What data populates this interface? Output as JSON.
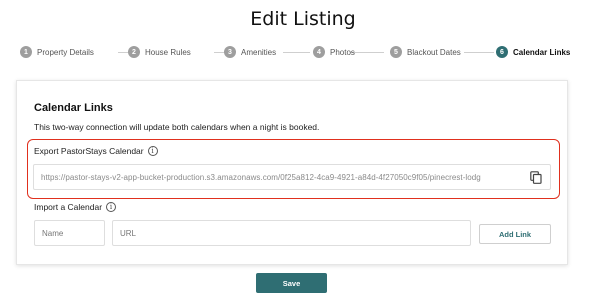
{
  "page": {
    "title": "Edit Listing"
  },
  "stepper": {
    "steps": [
      {
        "number": "1",
        "label": "Property Details"
      },
      {
        "number": "2",
        "label": "House Rules"
      },
      {
        "number": "3",
        "label": "Amenities"
      },
      {
        "number": "4",
        "label": "Photos"
      },
      {
        "number": "5",
        "label": "Blackout Dates"
      },
      {
        "number": "6",
        "label": "Calendar Links"
      }
    ],
    "active_step": "6"
  },
  "card": {
    "title": "Calendar Links",
    "description": "This two-way connection will update both calendars when a night is booked.",
    "export": {
      "label": "Export PastorStays Calendar",
      "url": "https://pastor-stays-v2-app-bucket-production.s3.amazonaws.com/0f25a812-4ca9-4921-a84d-4f27050c9f05/pinecrest-lodg"
    },
    "import": {
      "label": "Import a Calendar",
      "name_placeholder": "Name",
      "url_placeholder": "URL",
      "add_link_label": "Add Link"
    }
  },
  "actions": {
    "save_label": "Save"
  },
  "colors": {
    "accent": "#2f6e73",
    "highlight": "#e0301e",
    "inactive_step": "#9e9e9e"
  }
}
